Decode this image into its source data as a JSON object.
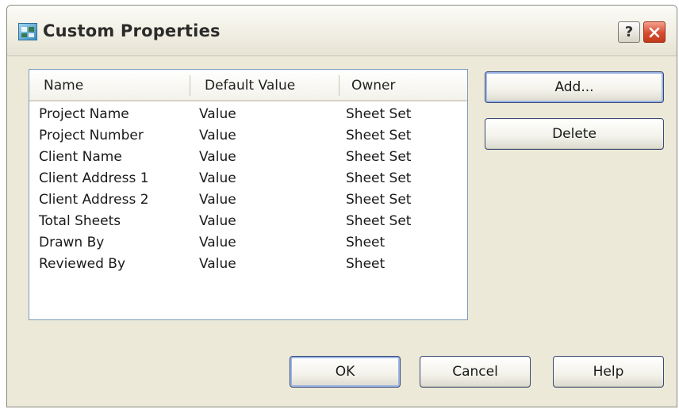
{
  "window": {
    "title": "Custom Properties",
    "icon": "sheet-set-app-icon",
    "title_buttons": [
      {
        "name": "help",
        "label": "?"
      },
      {
        "name": "close",
        "icon": "close-x-icon"
      }
    ]
  },
  "list": {
    "columns": [
      "Name",
      "Default Value",
      "Owner"
    ],
    "rows": [
      {
        "name": "Project Name",
        "value": "Value",
        "owner": "Sheet Set"
      },
      {
        "name": "Project Number",
        "value": "Value",
        "owner": "Sheet Set"
      },
      {
        "name": "Client Name",
        "value": "Value",
        "owner": "Sheet Set"
      },
      {
        "name": "Client Address 1",
        "value": "Value",
        "owner": "Sheet Set"
      },
      {
        "name": "Client Address 2",
        "value": "Value",
        "owner": "Sheet Set"
      },
      {
        "name": "Total Sheets",
        "value": "Value",
        "owner": "Sheet Set"
      },
      {
        "name": "Drawn By",
        "value": "Value",
        "owner": "Sheet"
      },
      {
        "name": "Reviewed By",
        "value": "Value",
        "owner": "Sheet"
      }
    ]
  },
  "side_buttons": {
    "add": "Add...",
    "delete": "Delete"
  },
  "footer_buttons": {
    "ok": "OK",
    "cancel": "Cancel",
    "help": "Help"
  },
  "colors": {
    "dialog_bg": "#ece9d8",
    "close_button": "#d64b2e",
    "button_border": "#3c4a73"
  }
}
